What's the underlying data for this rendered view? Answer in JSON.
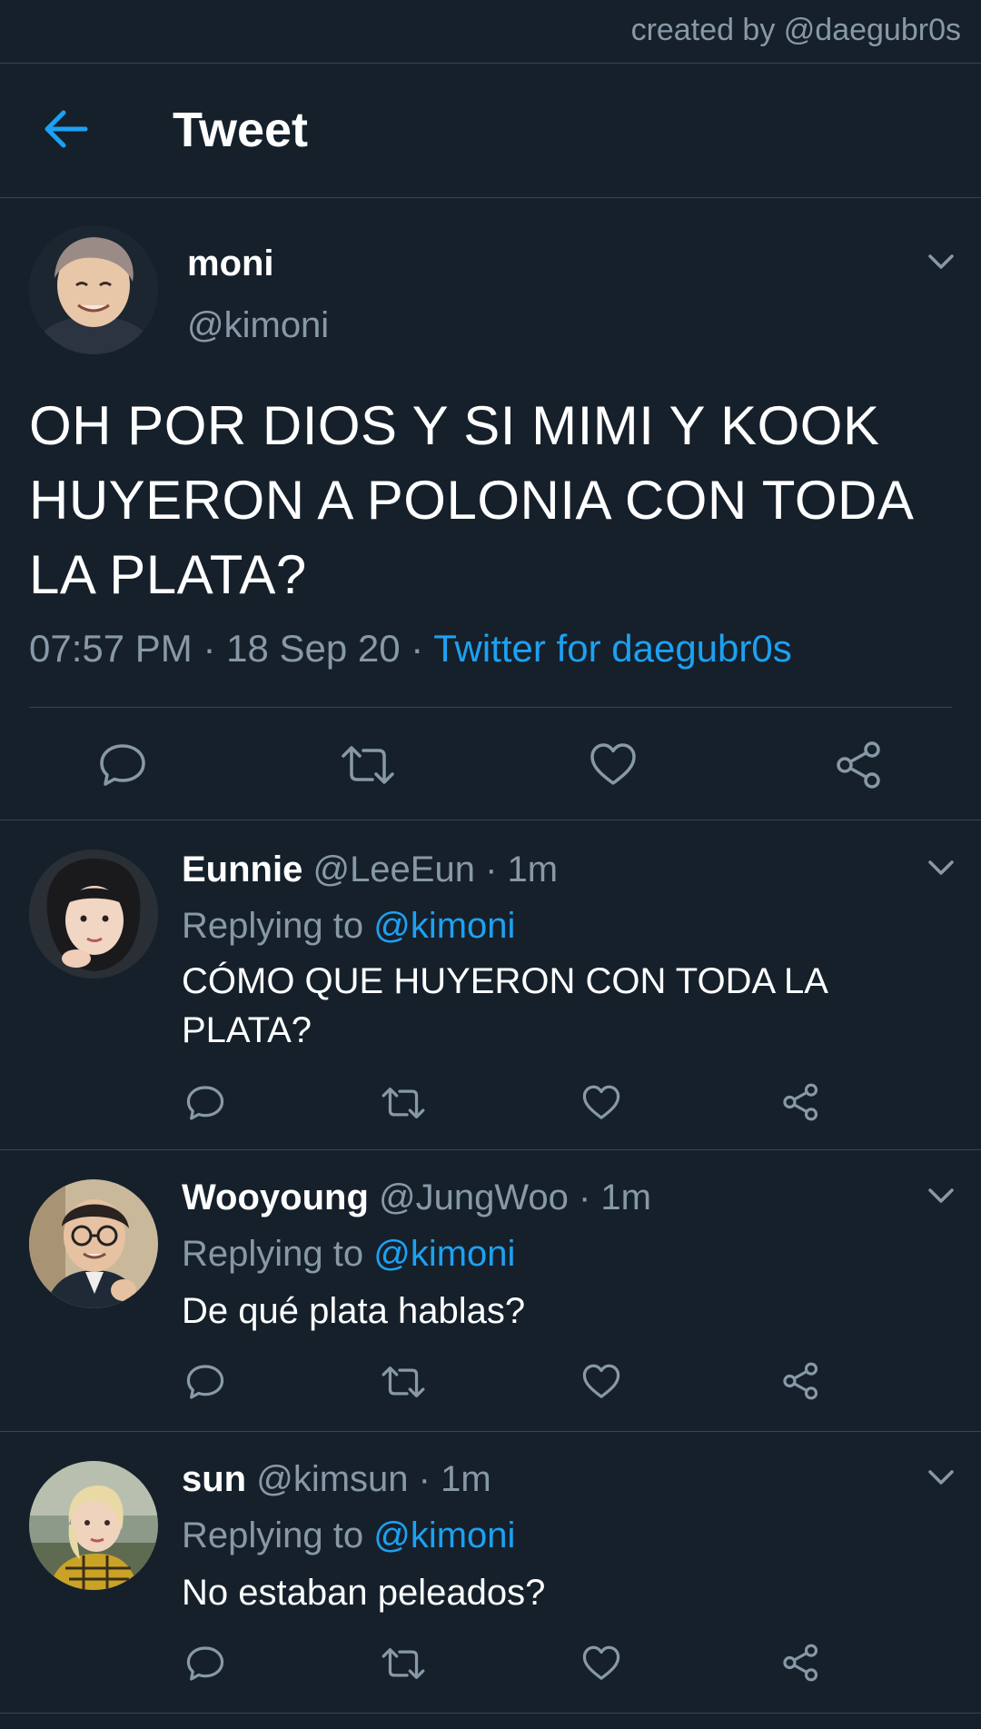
{
  "credit": "created by @daegubr0s",
  "header": {
    "title": "Tweet",
    "back_icon": "arrow-left-icon"
  },
  "colors": {
    "background": "#15202b",
    "accent": "#1da1f2",
    "secondary_text": "#8899a6",
    "divider": "#38444d"
  },
  "main_tweet": {
    "name": "moni",
    "handle": "@kimoni",
    "text": "OH POR DIOS Y SI MIMI Y KOOK HUYERON A POLONIA CON TODA LA PLATA?",
    "time": "07:57 PM",
    "sep1": " · ",
    "date": "18 Sep 20",
    "sep2": " · ",
    "source": "Twitter for daegubr0s",
    "actions": [
      "reply-icon",
      "retweet-icon",
      "like-icon",
      "share-icon"
    ]
  },
  "replies": [
    {
      "name": "Eunnie",
      "handle": " @LeeEun · 1m",
      "replying_label": "Replying to ",
      "replying_to": "@kimoni",
      "text": "CÓMO QUE HUYERON CON TODA LA PLATA?"
    },
    {
      "name": "Wooyoung",
      "handle": " @JungWoo · 1m",
      "replying_label": "Replying to ",
      "replying_to": "@kimoni",
      "text": "De qué plata hablas?"
    },
    {
      "name": "sun",
      "handle": " @kimsun · 1m",
      "replying_label": "Replying to ",
      "replying_to": "@kimoni",
      "text": "No estaban peleados?"
    }
  ]
}
